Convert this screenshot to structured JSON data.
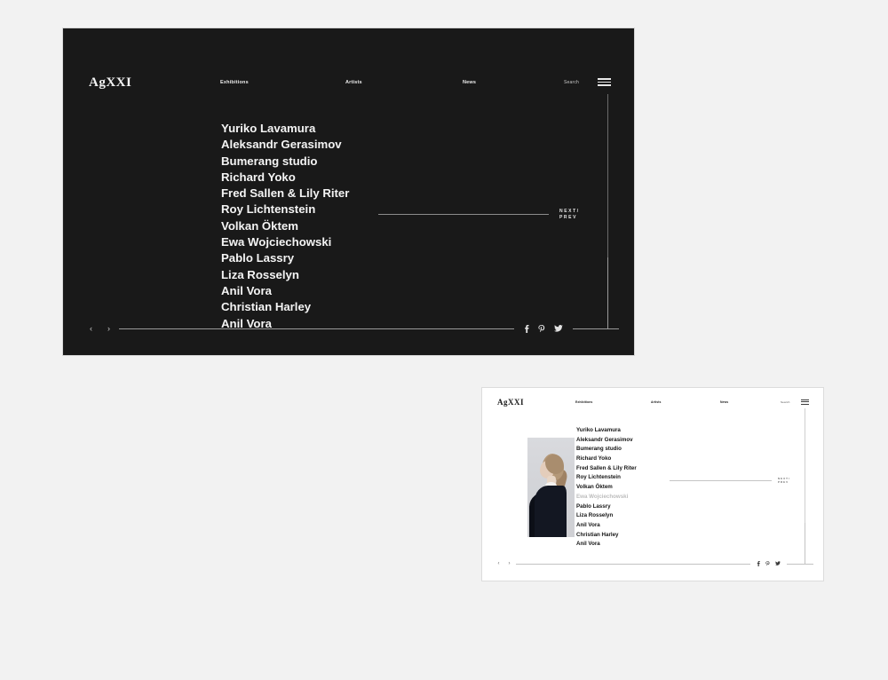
{
  "page": {
    "background_color": "#f2f2f2"
  },
  "panels": {
    "dark": {
      "name": "desktop-dark",
      "background_color": "#191919",
      "text_color": "#f4f4f4"
    },
    "light": {
      "name": "desktop-light-hover",
      "background_color": "#ffffff",
      "text_color": "#141414",
      "dim_color": "#b9b9b9"
    }
  },
  "header": {
    "logo": "AgXXI",
    "nav": [
      {
        "label": "Exhibitions"
      },
      {
        "label": "Artists"
      },
      {
        "label": "News"
      }
    ],
    "search_label": "Search",
    "menu_icon": "hamburger-menu-icon"
  },
  "artists": {
    "items": [
      {
        "name": "Yuriko Lavamura",
        "state": "default"
      },
      {
        "name": "Aleksandr Gerasimov",
        "state": "default"
      },
      {
        "name": "Bumerang studio",
        "state": "default"
      },
      {
        "name": "Richard Yoko",
        "state": "default"
      },
      {
        "name": "Fred Sallen & Lily Riter",
        "state": "default"
      },
      {
        "name": "Roy Lichtenstein",
        "state": "default"
      },
      {
        "name": "Volkan Öktem",
        "state": "default"
      },
      {
        "name": "Ewa Wojciechowski",
        "state": "hovered"
      },
      {
        "name": "Pablo Lassry",
        "state": "default"
      },
      {
        "name": "Liza Rosselyn",
        "state": "default"
      },
      {
        "name": "Anil Vora",
        "state": "default"
      },
      {
        "name": "Christian Harley",
        "state": "default"
      },
      {
        "name": "Anil Vora",
        "state": "default"
      }
    ],
    "hovered_index": 7
  },
  "pagination": {
    "next_label": "NEXT/",
    "prev_label": "PREV"
  },
  "footer": {
    "prev_arrow": "‹",
    "next_arrow": "›",
    "socials": [
      {
        "name": "facebook-icon",
        "glyph": "f"
      },
      {
        "name": "pinterest-icon",
        "glyph": "P"
      },
      {
        "name": "twitter-icon",
        "glyph": "t"
      }
    ]
  },
  "hover_preview": {
    "artist": "Ewa Wojciechowski",
    "alt": "portrait of woman in profile with ponytail wearing dark coat"
  }
}
